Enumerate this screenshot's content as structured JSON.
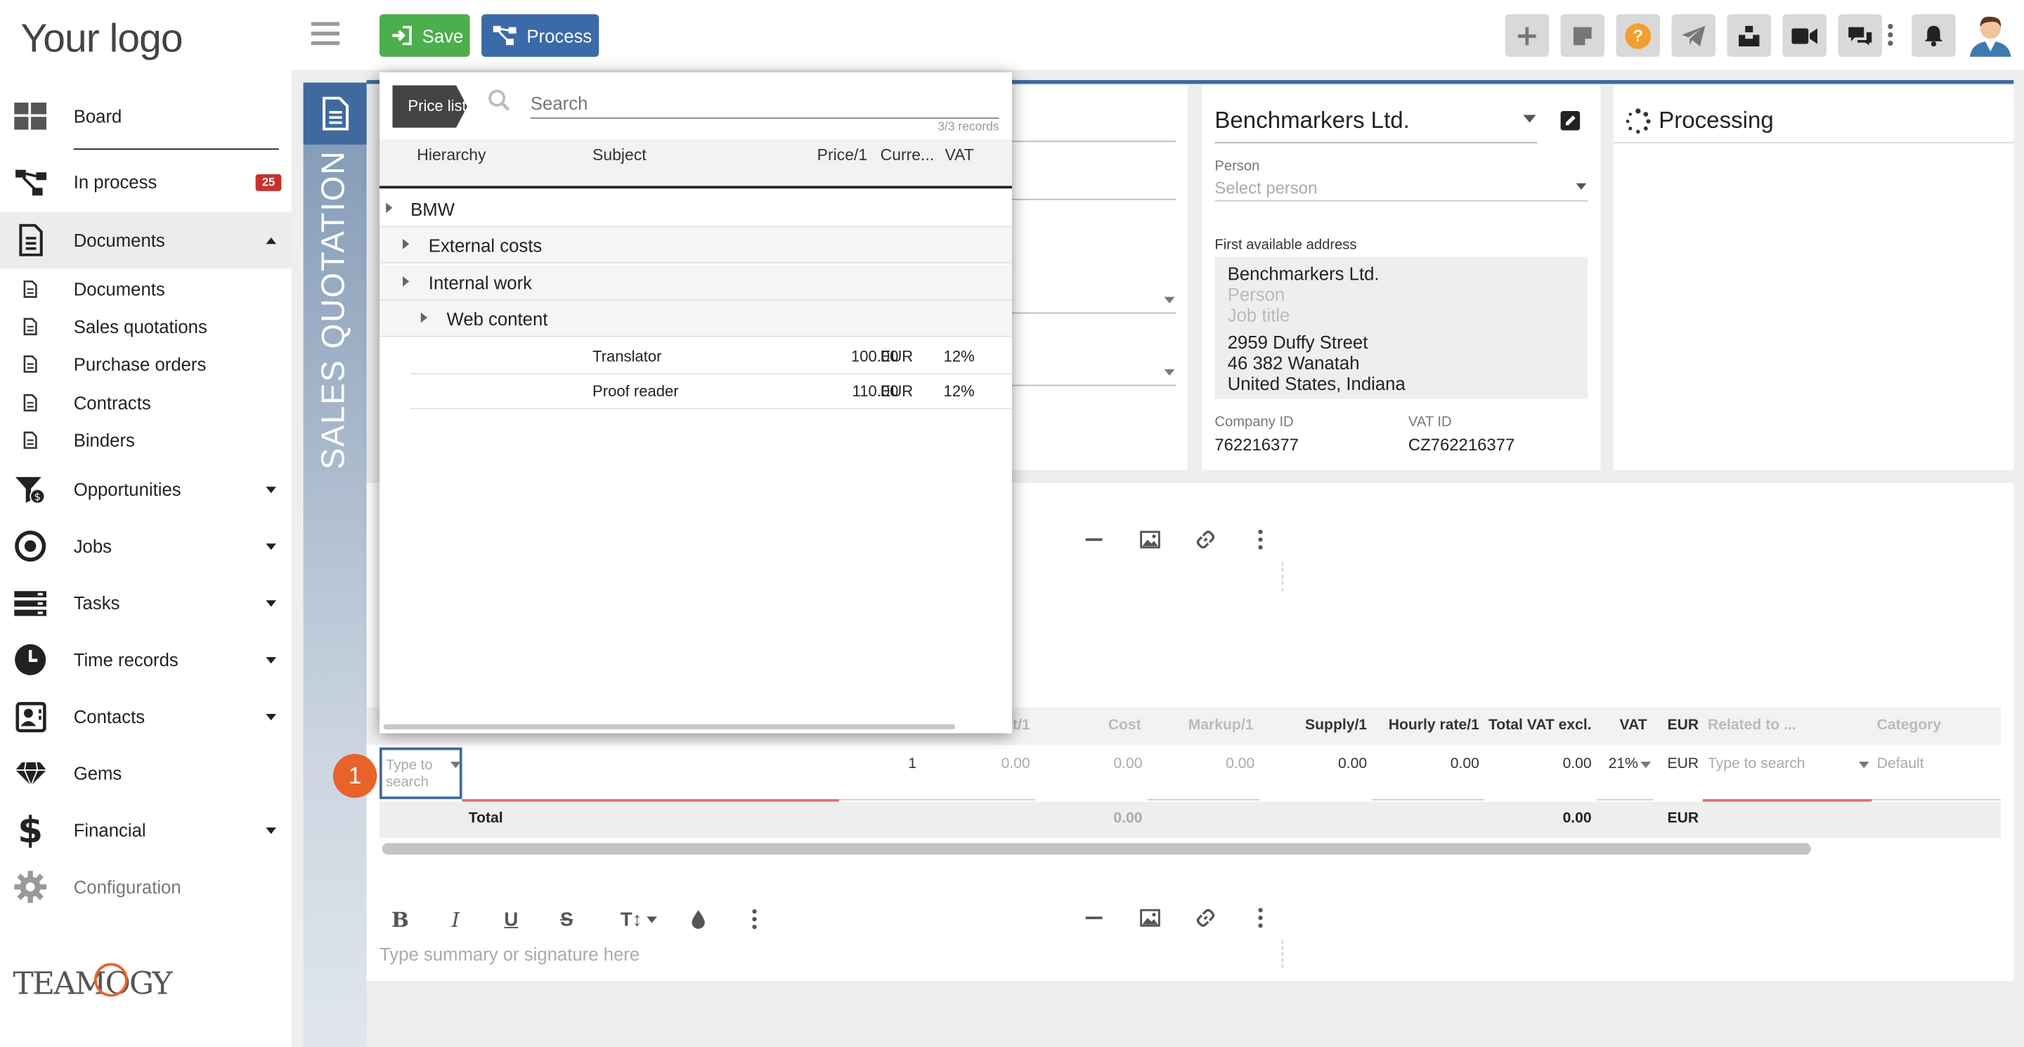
{
  "logo_text": "Your logo",
  "sidebar": {
    "items": [
      {
        "label": "Board",
        "icon": "board-icon"
      },
      {
        "label": "In process",
        "icon": "process-icon",
        "badge": "25"
      },
      {
        "label": "Documents",
        "icon": "document-icon",
        "expanded": true
      },
      {
        "label": "Opportunities",
        "icon": "funnel-icon"
      },
      {
        "label": "Jobs",
        "icon": "target-icon"
      },
      {
        "label": "Tasks",
        "icon": "tasks-icon"
      },
      {
        "label": "Time records",
        "icon": "clock-icon"
      },
      {
        "label": "Contacts",
        "icon": "contacts-icon"
      },
      {
        "label": "Gems",
        "icon": "gem-icon"
      },
      {
        "label": "Financial",
        "icon": "dollar-icon"
      },
      {
        "label": "Configuration",
        "icon": "gear-icon"
      }
    ],
    "sub_items": [
      "Documents",
      "Sales quotations",
      "Purchase orders",
      "Contracts",
      "Binders"
    ],
    "footer_logo": "TEAMOGY"
  },
  "toolbar": {
    "save_label": "Save",
    "process_label": "Process"
  },
  "colors": {
    "save": "#4cae4c",
    "process": "#3a6aa7",
    "badge": "#c9302c",
    "marker": "#e8632b",
    "help": "#f0a030"
  },
  "document": {
    "type_label": "SALES QUOTATION",
    "company": "Benchmarkers Ltd.",
    "person_label": "Person",
    "person_placeholder": "Select person",
    "address_label": "First available address",
    "address": {
      "company": "Benchmarkers Ltd.",
      "person_placeholder": "Person",
      "job_placeholder": "Job title",
      "street": "2959 Duffy Street",
      "city": "46 382 Wanatah",
      "region": "United States, Indiana"
    },
    "company_id_label": "Company ID",
    "company_id": "762216377",
    "vat_id_label": "VAT ID",
    "vat_id": "CZ762216377",
    "status": "Processing"
  },
  "price_list": {
    "tab_label": "Price list",
    "search_placeholder": "Search",
    "records": "3/3 records",
    "columns": [
      "Hierarchy",
      "Subject",
      "Price/1",
      "Curre...",
      "VAT"
    ],
    "groups": [
      "BMW",
      "External costs",
      "Internal work",
      "Web content"
    ],
    "items": [
      {
        "subject": "Translator",
        "price": "100.00",
        "currency": "EUR",
        "vat": "12%"
      },
      {
        "subject": "Proof reader",
        "price": "110.00",
        "currency": "EUR",
        "vat": "12%"
      }
    ]
  },
  "grid": {
    "headers": [
      "t/1",
      "Cost",
      "Markup/1",
      "Supply/1",
      "Hourly rate/1",
      "Total VAT excl.",
      "VAT",
      "EUR",
      "Related to ...",
      "Category"
    ],
    "row": {
      "item_placeholder": "Type to search",
      "quantity": "1",
      "price": "0.00",
      "cost": "0.00",
      "markup": "0.00",
      "supply": "0.00",
      "hourly": "0.00",
      "total": "0.00",
      "vat": "21%",
      "currency": "EUR",
      "related_placeholder": "Type to search",
      "category_placeholder": "Default"
    },
    "total_label": "Total",
    "total_cost": "0.00",
    "total_value": "0.00",
    "total_currency": "EUR",
    "row_marker": "1"
  },
  "summary_placeholder": "Type summary or signature here"
}
